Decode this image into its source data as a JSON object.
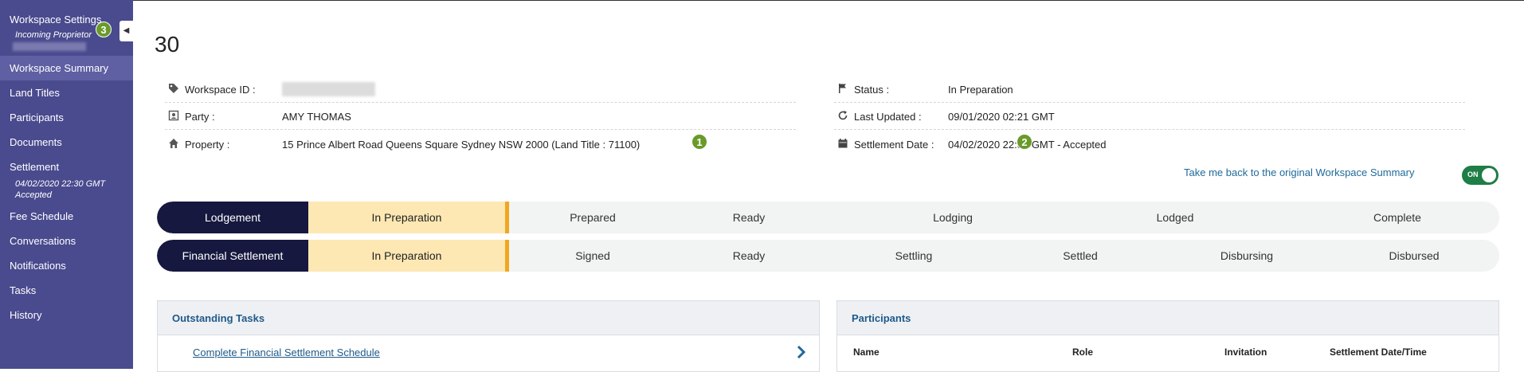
{
  "sidebar": {
    "title": "Workspace Settings",
    "subtitle": "Incoming Proprietor",
    "badge": "3",
    "collapse_icon": "chevron-left-icon",
    "items": [
      {
        "label": "Workspace Summary",
        "active": true
      },
      {
        "label": "Land Titles"
      },
      {
        "label": "Participants"
      },
      {
        "label": "Documents"
      },
      {
        "label": "Settlement",
        "sub1": "04/02/2020 22:30 GMT",
        "sub2": "Accepted"
      },
      {
        "label": "Fee Schedule"
      },
      {
        "label": "Conversations"
      },
      {
        "label": "Notifications"
      },
      {
        "label": "Tasks"
      },
      {
        "label": "History"
      }
    ]
  },
  "workspace": {
    "number": "30",
    "left": {
      "workspace_id_label": "Workspace ID :",
      "party_label": "Party :",
      "party_value": "AMY THOMAS",
      "property_label": "Property :",
      "property_value": "15 Prince Albert Road Queens Square Sydney NSW 2000 (Land Title : 71100)",
      "property_badge": "1"
    },
    "right": {
      "status_label": "Status :",
      "status_value": "In Preparation",
      "updated_label": "Last Updated :",
      "updated_value": "09/01/2020 02:21 GMT",
      "settlement_label": "Settlement Date :",
      "settlement_value": "04/02/2020 22:30 GMT - Accepted",
      "settlement_badge": "2"
    },
    "icons": {
      "workspace_id": "tag-icon",
      "party": "id-badge-icon",
      "property": "home-icon",
      "status": "flag-icon",
      "updated": "refresh-icon",
      "settlement": "calendar-icon"
    }
  },
  "back_link": "Take me back to the original Workspace Summary",
  "toggle": {
    "label": "ON",
    "state": "on"
  },
  "lodgement": {
    "label": "Lodgement",
    "current": "In Preparation",
    "steps": [
      "Prepared",
      "Ready",
      "Lodging",
      "Lodged",
      "Complete"
    ]
  },
  "financial": {
    "label": "Financial Settlement",
    "current": "In Preparation",
    "steps": [
      "Signed",
      "Ready",
      "Settling",
      "Settled",
      "Disbursing",
      "Disbursed"
    ]
  },
  "tasks_panel": {
    "title": "Outstanding Tasks",
    "task": "Complete Financial Settlement Schedule"
  },
  "participants_panel": {
    "title": "Participants",
    "columns": [
      "Name",
      "Role",
      "Invitation",
      "Settlement Date/Time"
    ]
  },
  "colors": {
    "sidebar": "#4a4a8f",
    "stage_label": "#16183f",
    "stage_current": "#fde8b4",
    "accent": "#f0a821",
    "badge": "#6a9a2a",
    "toggle": "#1e7e45",
    "link": "#1f5a8a"
  }
}
